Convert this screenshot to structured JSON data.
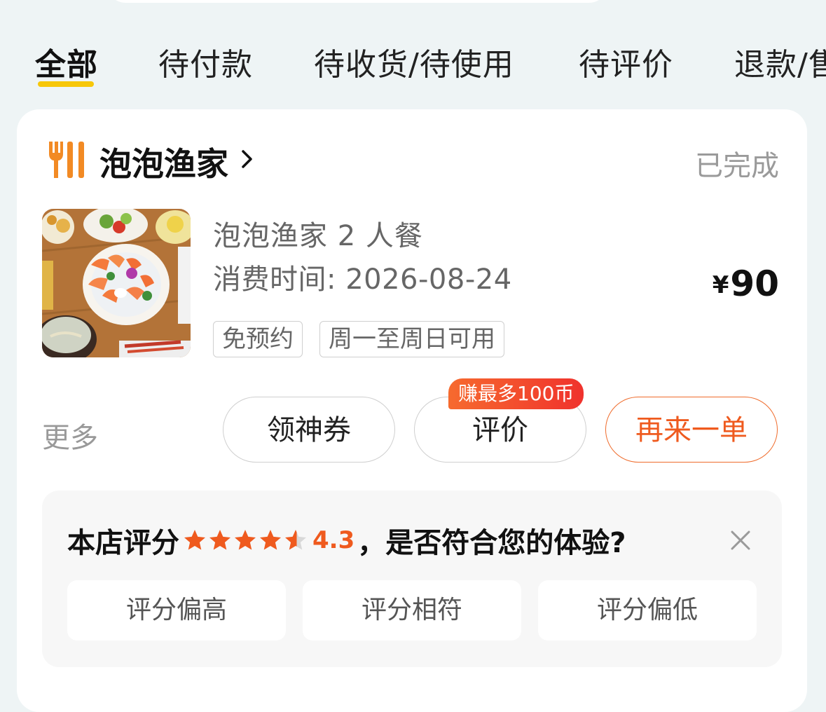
{
  "tabs": [
    {
      "label": "全部",
      "active": true
    },
    {
      "label": "待付款",
      "active": false
    },
    {
      "label": "待收货/待使用",
      "active": false
    },
    {
      "label": "待评价",
      "active": false
    },
    {
      "label": "退款/售后",
      "active": false
    }
  ],
  "order": {
    "shop_name": "泡泡渔家",
    "status": "已完成",
    "product_name": "泡泡渔家 2 人餐",
    "consume_time": "消费时间: 2026-08-24",
    "tags": [
      "免预约",
      "周一至周日可用"
    ],
    "price_symbol": "¥",
    "price": "90",
    "more_label": "更多",
    "buttons": {
      "coupon": "领神券",
      "review": "评价",
      "reorder": "再来一单"
    },
    "review_badge": "赚最多100币"
  },
  "rating_panel": {
    "prefix": "本店评分",
    "score": "4.3",
    "question": "，是否符合您的体验?",
    "stars_value": 4.3,
    "stars_max": 5,
    "options": [
      "评分偏高",
      "评分相符",
      "评分偏低"
    ]
  },
  "colors": {
    "accent": "#ef5a1e",
    "tab_underline": "#f7c709",
    "star": "#ef5a1e"
  },
  "icons": {
    "shop": "fork-knife-icon",
    "chevron": "chevron-right-icon",
    "close": "close-icon",
    "star": "star-icon"
  }
}
